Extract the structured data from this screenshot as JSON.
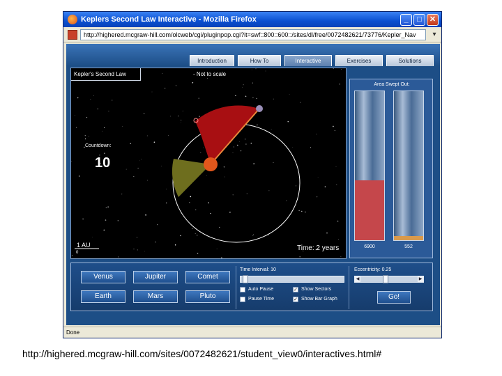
{
  "window": {
    "title": "Keplers Second Law Interactive - Mozilla Firefox",
    "url": "http://highered.mcgraw-hill.com/olcweb/cgi/pluginpop.cgi?it=swf::800::600::/sites/dl/free/0072482621/73776/Kepler_Nav",
    "status": "Done",
    "minimize_glyph": "_",
    "maximize_glyph": "□",
    "close_glyph": "✕"
  },
  "tabs": [
    {
      "label": "Introduction",
      "active": false
    },
    {
      "label": "How To",
      "active": false
    },
    {
      "label": "Interactive",
      "active": true
    },
    {
      "label": "Exercises",
      "active": false
    },
    {
      "label": "Solutions",
      "active": false
    }
  ],
  "sim": {
    "panel_title": "Kepler's Second Law",
    "scale_note": "- Not to scale",
    "countdown_label": "Countdown:",
    "countdown_value": "10",
    "scale_label": "1 AU",
    "scale_zero": "0",
    "time_label": "Time: 2 years"
  },
  "area_panel": {
    "title": "Area Swept Out:",
    "bars": [
      {
        "value": "6900",
        "fill_fraction": 0.4,
        "color": "#c5474b"
      },
      {
        "value": "552",
        "fill_fraction": 0.03,
        "color": "#d99a4c"
      }
    ]
  },
  "controls": {
    "planets": [
      "Venus",
      "Jupiter",
      "Comet",
      "Earth",
      "Mars",
      "Pluto"
    ],
    "time_interval_label": "Time Interval: 10",
    "time_interval_fraction": 0.02,
    "eccentricity_label": "Eccentricity: 0.25",
    "eccentricity_fraction": 0.4,
    "options": [
      {
        "label": "Auto Pause",
        "checked": false
      },
      {
        "label": "Show Sectors",
        "checked": true
      },
      {
        "label": "Pause Time",
        "checked": false
      },
      {
        "label": "Show Bar Graph",
        "checked": true
      }
    ],
    "go_label": "Go!",
    "check_glyph": "✓",
    "left_arrow": "◀",
    "right_arrow": "▶"
  },
  "caption": "http://highered.mcgraw-hill.com/sites/0072482621/student_view0/interactives.html#",
  "colors": {
    "sector_red": "#a80f12",
    "sector_olive": "#6e6e1e",
    "sun": "#e2571c",
    "orbit": "#ffffff",
    "planet": "#9a8fb8"
  },
  "icons": {
    "browser": "firefox-icon",
    "page": "page-icon"
  }
}
